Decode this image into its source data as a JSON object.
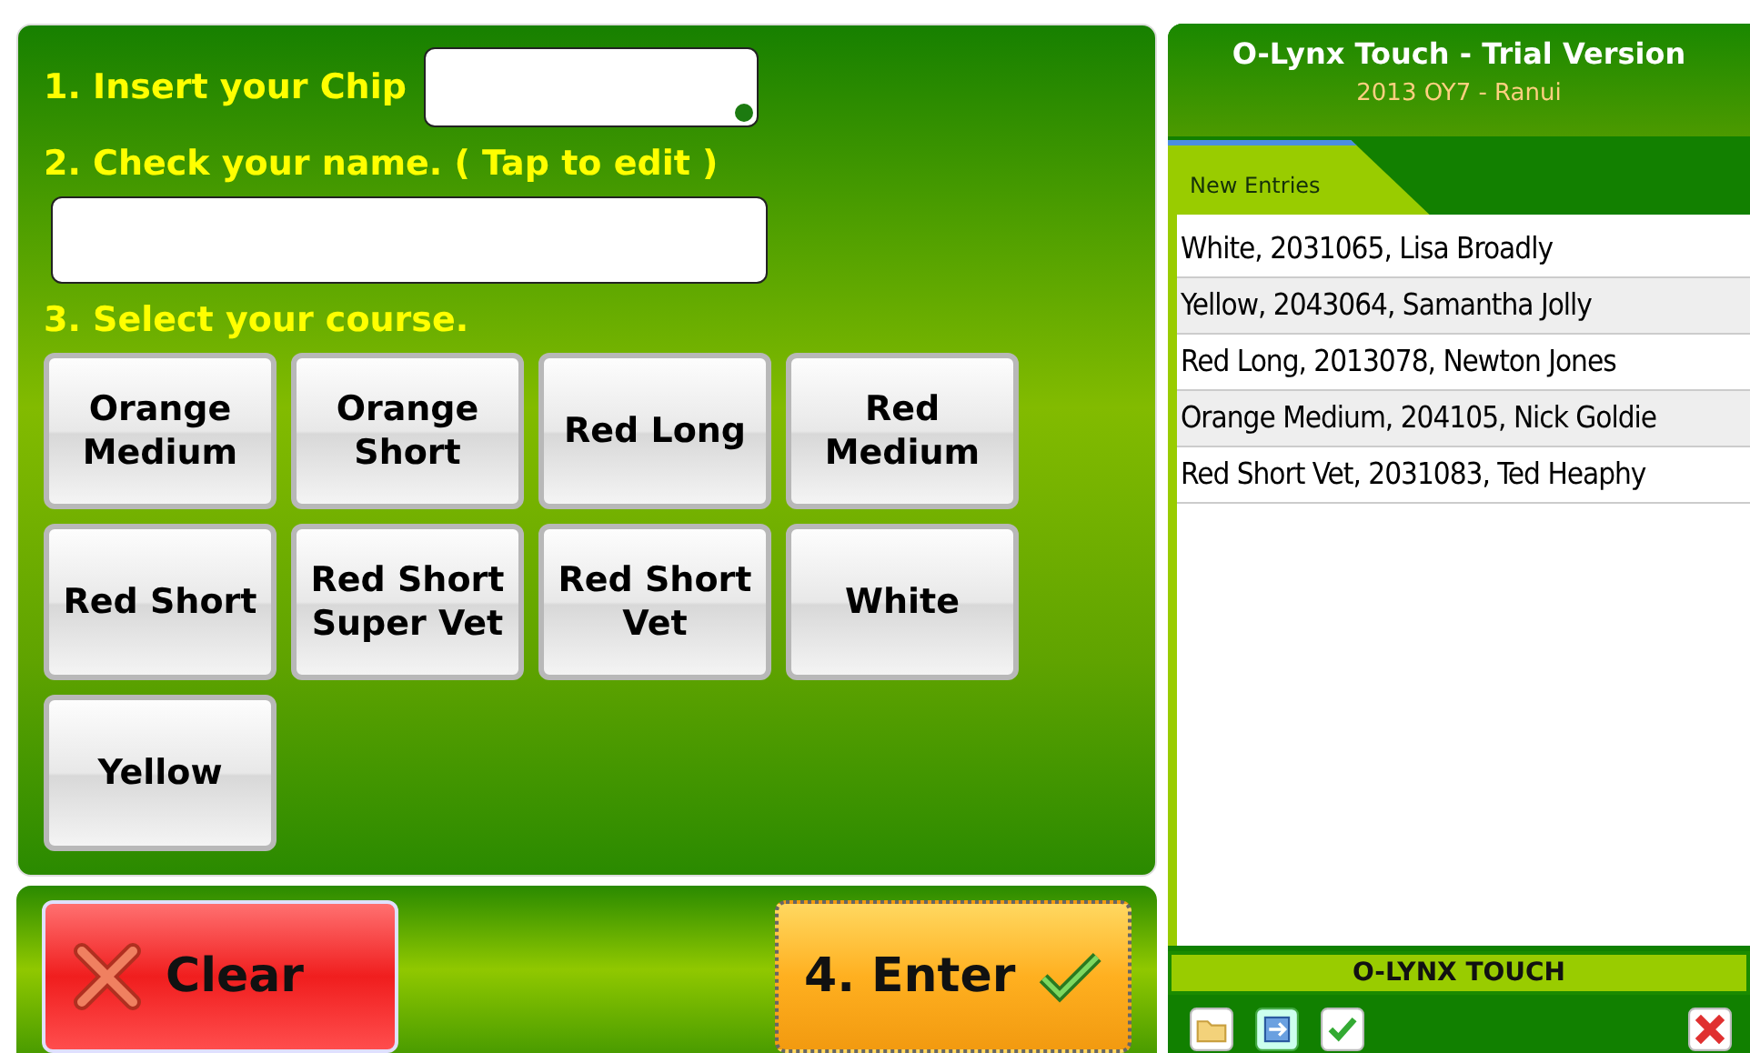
{
  "steps": [
    {
      "kind": "chip",
      "label": "1. Insert your Chip"
    },
    {
      "kind": "name",
      "label": "2. Check your name. ( Tap to edit )"
    },
    {
      "kind": "course",
      "label": "3. Select your course."
    }
  ],
  "courses": [
    "Orange\nMedium",
    "Orange\nShort",
    "Red Long",
    "Red\nMedium",
    "Red Short",
    "Red Short\nSuper Vet",
    "Red Short\nVet",
    "White",
    "Yellow"
  ],
  "actions": [
    {
      "kind": "clear",
      "label": "Clear"
    },
    {
      "kind": "enter",
      "label": "4. Enter"
    }
  ],
  "header": {
    "title": "O-Lynx Touch - Trial Version",
    "subtitle": "2013 OY7 - Ranui"
  },
  "tabs": [
    {
      "label": "New Entries",
      "selected": true
    }
  ],
  "entries": [
    "White, 2031065, Lisa Broadly",
    "Yellow, 2043064, Samantha Jolly",
    "Red Long, 2013078, Newton Jones",
    "Orange Medium, 204105, Nick Goldie",
    "Red Short Vet, 2031083, Ted Heaphy"
  ],
  "footer": {
    "title": "O-LYNX TOUCH"
  }
}
